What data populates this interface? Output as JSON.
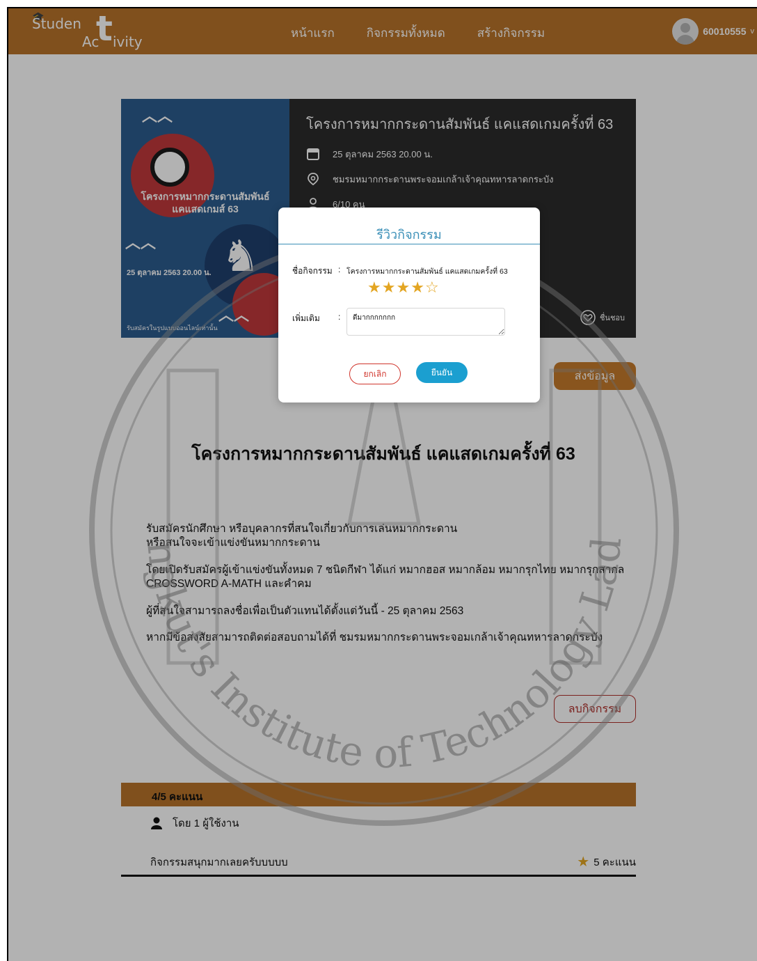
{
  "nav": {
    "logo_part1": "Studen",
    "logo_big_t": "t",
    "logo_part2": "Ac",
    "logo_part3": "ivity",
    "links": [
      "หน้าแรก",
      "กิจกรรมทั้งหมด",
      "สร้างกิจกรรม"
    ],
    "user_id": "60010555",
    "caret": "v"
  },
  "activity": {
    "title": "โครงการหมากกระดานสัมพันธ์ แคแสดเกมครั้งที่ 63",
    "date": "25 ตุลาคม 2563  20.00 น.",
    "location": "ชมรมหมากกระดานพระจอมเกล้าเจ้าคุณทหารลาดกระบัง",
    "participants": "6/10  คน",
    "like_label": "ชื่นชอบ",
    "send_button": "ส่งข้อมูล",
    "delete_button": "ลบกิจกรรม",
    "detail_title": "โครงการหมากกระดานสัมพันธ์ แคแสดเกมครั้งที่ 63",
    "detail_paragraphs": [
      "รับสมัครนักศึกษา หรือบุคลากรที่สนใจเกี่ยวกับการเล่นหมากกระดาน\nหรือสนใจจะเข้าแข่งขันหมากกระดาน",
      "โดยเปิดรับสมัครผู้เข้าแข่งขันทั้งหมด 7 ชนิดกีฬา ได้แก่  หมากฮอส หมากล้อม หมากรุกไทย หมากรุกสากล\nCROSSWORD A-MATH และคำคม",
      "ผู้ที่สนใจสามารถลงชื่อเพื่อเป็นตัวแทนได้ตั้งแต่วันนี้ - 25 ตุลาคม 2563",
      "หากมีข้อสงสัยสามารถติดต่อสอบถามได้ที่ ชมรมหมากกระดานพระจอมเกล้าเจ้าคุณทหารลาดกระบัง"
    ]
  },
  "poster": {
    "title": "โครงการหมากกระดานสัมพันธ์\nแคแสดเกมส์ 63",
    "date": "25 ตุลาคม 2563 20.00 น.",
    "footer": "รับสมัครในรูปแบบออนไลน์เท่านั้น"
  },
  "reviews": {
    "score": "4/5 คะแนน",
    "by": "โดย 1 ผู้ใช้งาน",
    "items": [
      {
        "text": "กิจกรรมสนุกมากเลยครับบบบบ",
        "score": "5 คะแนน"
      }
    ]
  },
  "modal": {
    "title": "รีวิวกิจกรรม",
    "name_label": "ชื่อกิจกรรม",
    "name_value": "โครงการหมากกระดานสัมพันธ์ แคแสดเกมครั้งที่ 63",
    "rating": 4,
    "rating_max": 5,
    "extra_label": "เพิ่มเติม",
    "extra_value": "ดีมากกกกกกก",
    "colon": ":",
    "cancel_button": "ยกเลิก",
    "confirm_button": "ยืนยัน"
  },
  "watermark": {
    "text": "King Mongkut's Institute of Technology Ladkrabang"
  },
  "colors": {
    "nav": "#b8732a",
    "accent_blue": "#1b9fd0",
    "danger": "#d0352c",
    "star": "#e3a522"
  }
}
